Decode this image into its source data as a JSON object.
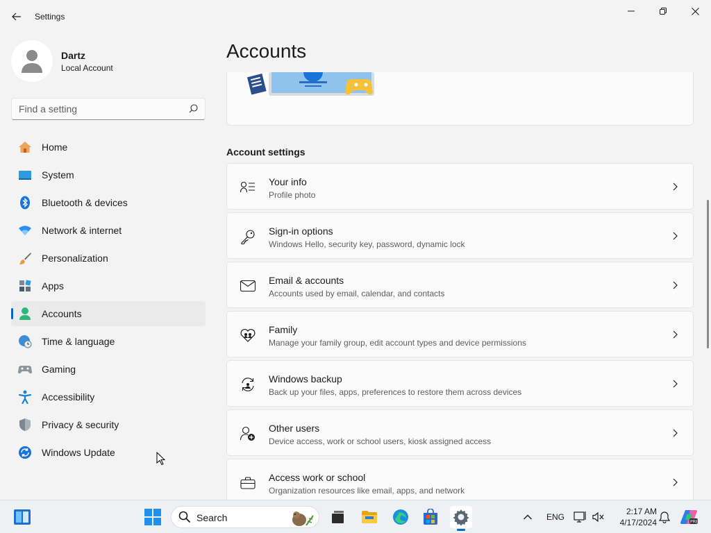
{
  "window": {
    "title": "Settings"
  },
  "profile": {
    "name": "Dartz",
    "account_type": "Local Account"
  },
  "search": {
    "placeholder": "Find a setting"
  },
  "sidebar": {
    "items": [
      {
        "label": "Home",
        "icon": "home-icon"
      },
      {
        "label": "System",
        "icon": "system-icon"
      },
      {
        "label": "Bluetooth & devices",
        "icon": "bluetooth-icon"
      },
      {
        "label": "Network & internet",
        "icon": "wifi-icon"
      },
      {
        "label": "Personalization",
        "icon": "brush-icon"
      },
      {
        "label": "Apps",
        "icon": "apps-icon"
      },
      {
        "label": "Accounts",
        "icon": "accounts-icon",
        "selected": true
      },
      {
        "label": "Time & language",
        "icon": "globe-clock-icon"
      },
      {
        "label": "Gaming",
        "icon": "gamepad-icon"
      },
      {
        "label": "Accessibility",
        "icon": "accessibility-icon"
      },
      {
        "label": "Privacy & security",
        "icon": "shield-icon"
      },
      {
        "label": "Windows Update",
        "icon": "update-icon"
      }
    ]
  },
  "main": {
    "title": "Accounts",
    "section_title": "Account settings",
    "cards": [
      {
        "title": "Your info",
        "subtitle": "Profile photo",
        "icon": "person-info-icon"
      },
      {
        "title": "Sign-in options",
        "subtitle": "Windows Hello, security key, password, dynamic lock",
        "icon": "key-icon"
      },
      {
        "title": "Email & accounts",
        "subtitle": "Accounts used by email, calendar, and contacts",
        "icon": "mail-icon"
      },
      {
        "title": "Family",
        "subtitle": "Manage your family group, edit account types and device permissions",
        "icon": "family-heart-icon"
      },
      {
        "title": "Windows backup",
        "subtitle": "Back up your files, apps, preferences to restore them across devices",
        "icon": "backup-icon"
      },
      {
        "title": "Other users",
        "subtitle": "Device access, work or school users, kiosk assigned access",
        "icon": "add-user-icon"
      },
      {
        "title": "Access work or school",
        "subtitle": "Organization resources like email, apps, and network",
        "icon": "briefcase-icon"
      }
    ]
  },
  "taskbar": {
    "search_label": "Search",
    "language": "ENG",
    "time": "2:17 AM",
    "date": "4/17/2024"
  },
  "colors": {
    "accent": "#0067c0",
    "background": "#f3f3f3",
    "card": "#fbfbfb"
  }
}
